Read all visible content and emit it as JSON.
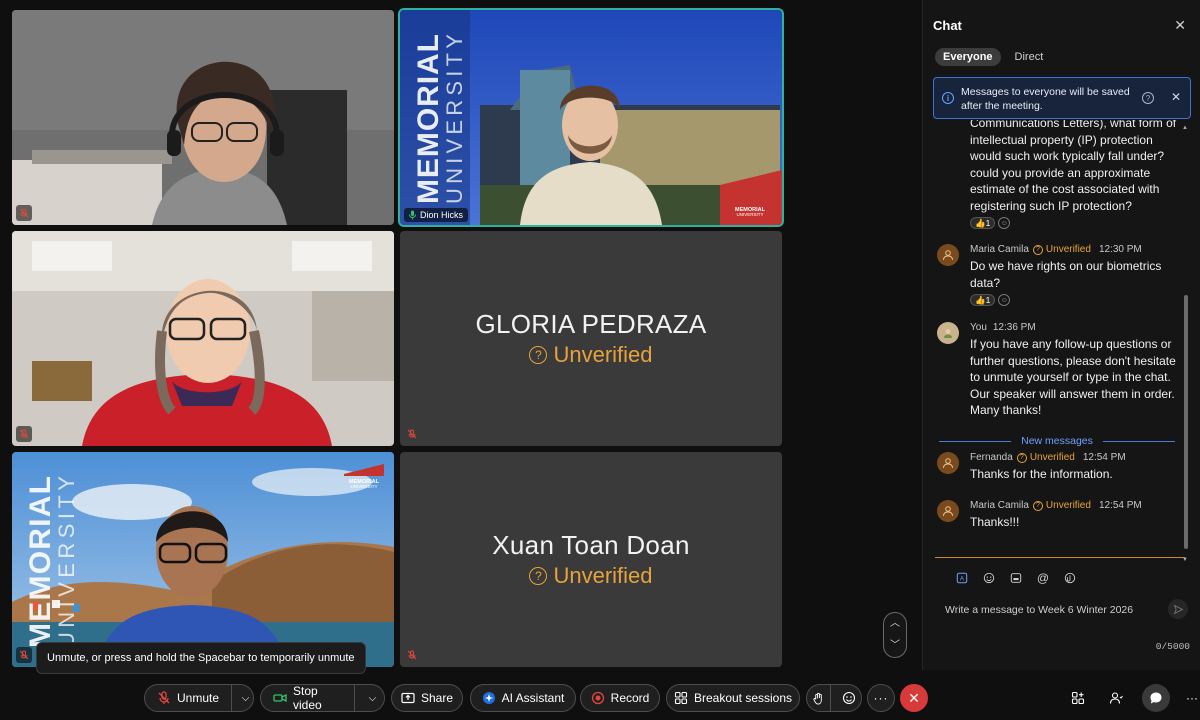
{
  "tiles": [
    {
      "name": "",
      "muted": true
    },
    {
      "name": "Dion Hicks",
      "muted": false,
      "watermark": "MEMORIAL UNIVERSITY",
      "logo": "MEMORIAL UNIVERSITY"
    },
    {
      "name": "",
      "muted": true
    },
    {
      "name": "GLORIA PEDRAZA",
      "status": "Unverified",
      "muted": true
    },
    {
      "name": "",
      "muted": true,
      "watermark": "MEMORIAL UNIVERSITY",
      "logo": "MEMORIAL UNIVERSITY"
    },
    {
      "name": "Xuan Toan Doan",
      "status": "Unverified",
      "muted": true
    }
  ],
  "tooltip": "Unmute, or press and hold the Spacebar to temporarily unmute",
  "controls": {
    "unmute": "Unmute",
    "stop_video": "Stop video",
    "share": "Share",
    "ai_assistant": "AI Assistant",
    "record": "Record",
    "breakout": "Breakout sessions"
  },
  "chat": {
    "title": "Chat",
    "tabs": [
      "Everyone",
      "Direct"
    ],
    "notice": "Messages to everyone will be saved after the meeting.",
    "truncated_message": "Communications Letters), what form of intellectual property (IP) protection would such work typically fall under? could you provide an approximate estimate of the cost associated with registering such IP protection?",
    "truncated_reaction": "👍1",
    "messages": [
      {
        "sender": "Maria Camila",
        "status": "Unverified",
        "time": "12:30 PM",
        "text": "Do we have rights on our biometrics data?",
        "reaction": "👍1"
      },
      {
        "sender": "You",
        "status": "",
        "time": "12:36 PM",
        "text": "If you have any follow-up questions or further questions, please don't hesitate to unmute yourself or type in the chat. Our speaker will answer them in order. Many thanks!"
      },
      {
        "sender": "Fernanda",
        "status": "Unverified",
        "time": "12:54 PM",
        "text": "Thanks for the information."
      },
      {
        "sender": "Maria Camila",
        "status": "Unverified",
        "time": "12:54 PM",
        "text": "Thanks!!!"
      }
    ],
    "new_messages_label": "New messages",
    "compose_placeholder": "Write a message to Week 6 Winter 2026",
    "char_count": "0/5000"
  },
  "colors": {
    "accent_blue": "#3d73d6",
    "unverified": "#e6a23c",
    "leave_red": "#d73a3a",
    "active_border": "#2fb1a0"
  }
}
